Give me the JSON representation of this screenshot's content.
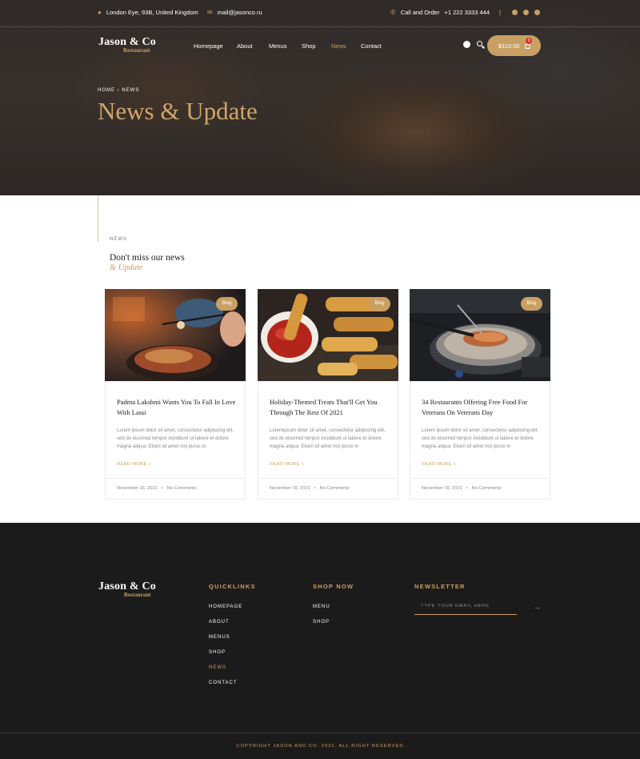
{
  "topbar": {
    "address": "London Eye, 93B, United Kingdom",
    "email": "mail@jasonco.ru",
    "call_label": "Call and Order",
    "phone": "+1 222 3333 444",
    "separator": "|"
  },
  "brand": {
    "name": "Jason & Co",
    "tagline": "Restaurant"
  },
  "nav": {
    "items": [
      "Homepage",
      "About",
      "Menus",
      "Shop",
      "News",
      "Contact"
    ],
    "active": "News"
  },
  "cart": {
    "total": "$110.00",
    "count": "3",
    "icon": "shopping-bag-icon"
  },
  "hero": {
    "breadcrumb": "HOME  ›  NEWS",
    "title": "News & Update"
  },
  "section": {
    "overline": "NEWS",
    "title": "Don't miss our news",
    "subtitle": "& Update"
  },
  "posts": [
    {
      "badge": "Blog",
      "title": "Padma Lakshmi Wants You To Fall In Love With Lassi",
      "excerpt": "Lorem ipsum dolor sit amet, consectetur adipiscing elit, sed do eiusmod tempor incididunt ut labore et dolore magna aliqua. Etiam sit amet nisl purus in",
      "more": "READ MORE »",
      "date": "November 16, 2021",
      "comments": "No Comments"
    },
    {
      "badge": "Blog",
      "title": "Holiday-Themed Treats That'll Get You Through The Rest Of 2021",
      "excerpt": "Loremipsum dolor sit amet, consectetur adipiscing elit, sed do eiusmod tempor incididunt ut labore et dolore magna aliqua. Etiam sit amet nisl purus in",
      "more": "READ MORE »",
      "date": "November 16, 2021",
      "comments": "No Comments"
    },
    {
      "badge": "Blog",
      "title": "34 Restaurants Offering Free Food For Veterans On Veterans Day",
      "excerpt": "Lorem ipsum dolor sit amet, consectetur adipiscing elit, sed do eiusmod tempor incididunt ut labore et dolore magna aliqua. Etiam sit amet nisl purus in",
      "more": "READ MORE »",
      "date": "November 16, 2021",
      "comments": "No Comments"
    }
  ],
  "footer": {
    "quicklinks_title": "QUICKLINKS",
    "quicklinks": [
      "HOMEPAGE",
      "ABOUT",
      "MENUS",
      "SHOP",
      "NEWS",
      "CONTACT"
    ],
    "quicklinks_active": "NEWS",
    "shop_title": "SHOP NOW",
    "shop_links": [
      "MENU",
      "SHOP"
    ],
    "newsletter_title": "NEWSLETTER",
    "newsletter_placeholder": "TYPE YOUR EMAIL HERE",
    "submit_arrow": "→",
    "copyright": "COPYRIGHT JASON AND CO. 2021. ALL RIGHT RESERVED"
  },
  "colors": {
    "accent": "#c9a063",
    "dark": "#1c1b1b",
    "badge_red": "#d9352b"
  }
}
